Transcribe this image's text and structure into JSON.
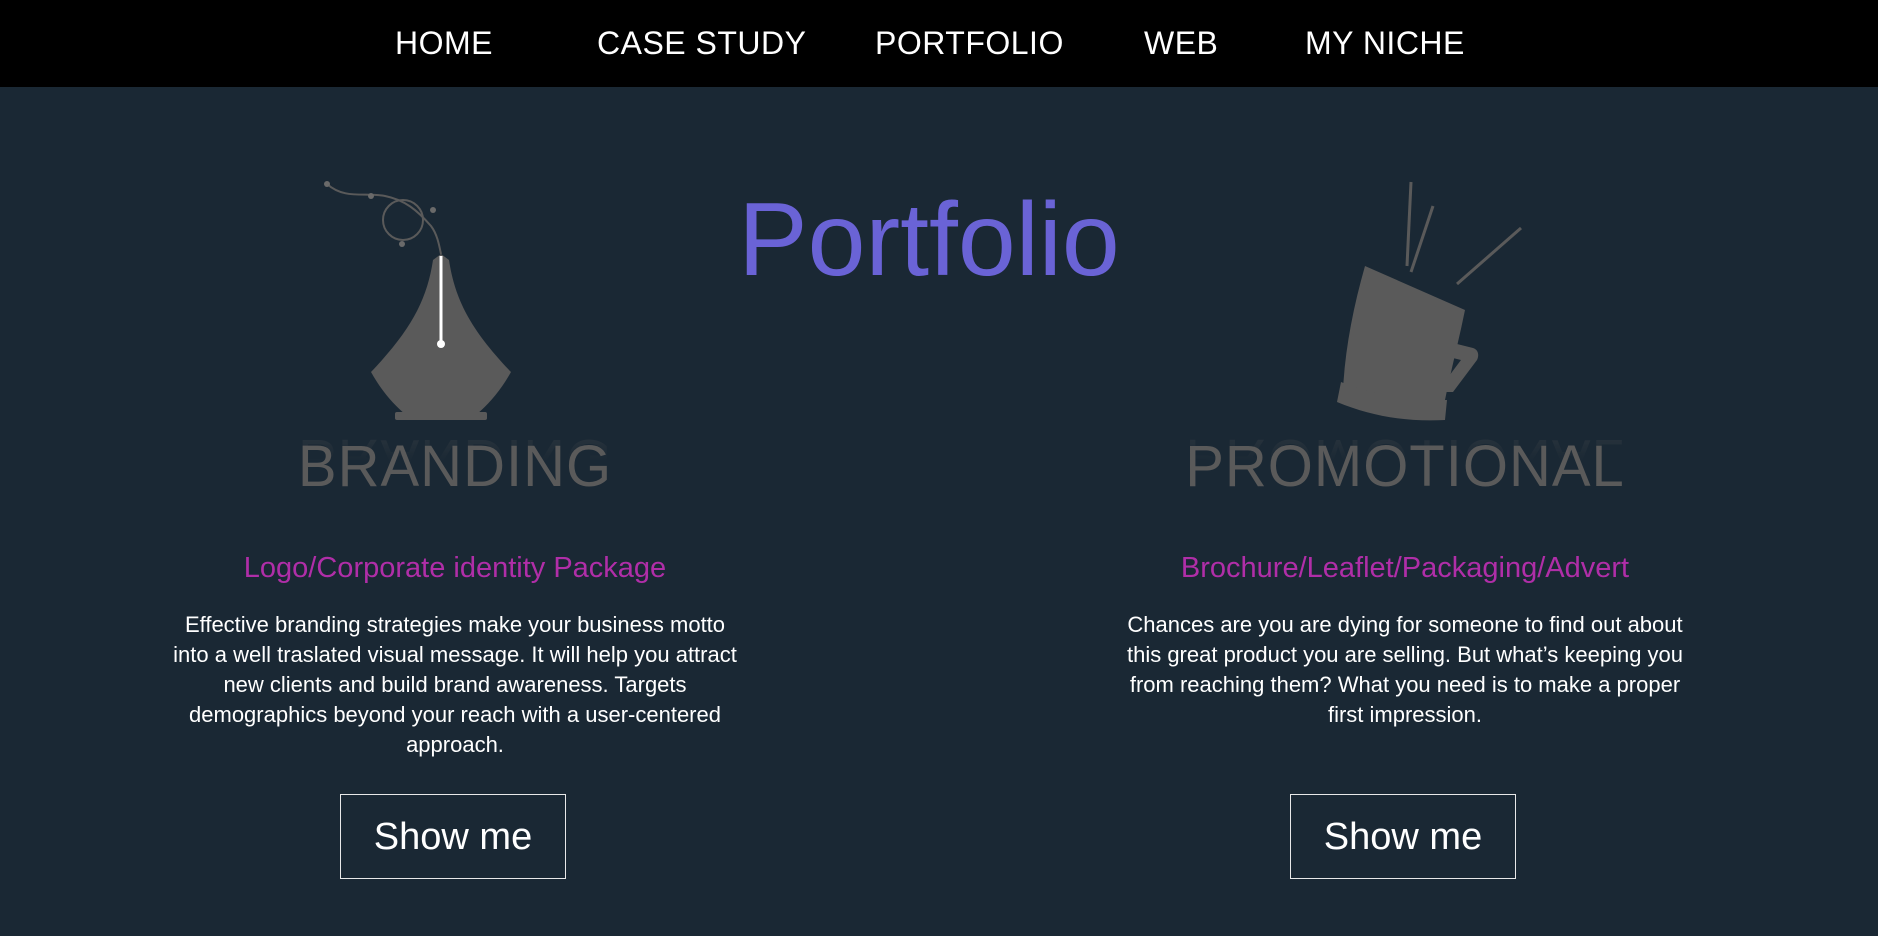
{
  "nav": {
    "items": [
      {
        "label": "HOME"
      },
      {
        "label": "CASE STUDY"
      },
      {
        "label": "PORTFOLIO"
      },
      {
        "label": "WEB"
      },
      {
        "label": "MY NICHE"
      }
    ]
  },
  "page": {
    "title": "Portfolio"
  },
  "sections": [
    {
      "icon": "pen-nib-icon",
      "word": "BRANDING",
      "subtitle": "Logo/Corporate identity Package",
      "description": "Effective branding strategies make your business motto into a well traslated visual message. It will help you attract new clients and build brand awareness. Targets demographics beyond your reach with a user-centered approach.",
      "button_label": "Show me"
    },
    {
      "icon": "megaphone-icon",
      "word": "PROMOTIONAL",
      "subtitle": "Brochure/Leaflet/Packaging/Advert",
      "description": "Chances are you are dying for someone to find out about this great product you are selling. But what’s keeping you from reaching them? What you need is to make a proper first impression.",
      "button_label": "Show me"
    }
  ],
  "colors": {
    "background": "#1a2834",
    "nav_background": "#000000",
    "title": "#6a63d6",
    "subtitle": "#b02ea8",
    "icon_gray": "#5a5a5a",
    "text": "#ffffff"
  }
}
